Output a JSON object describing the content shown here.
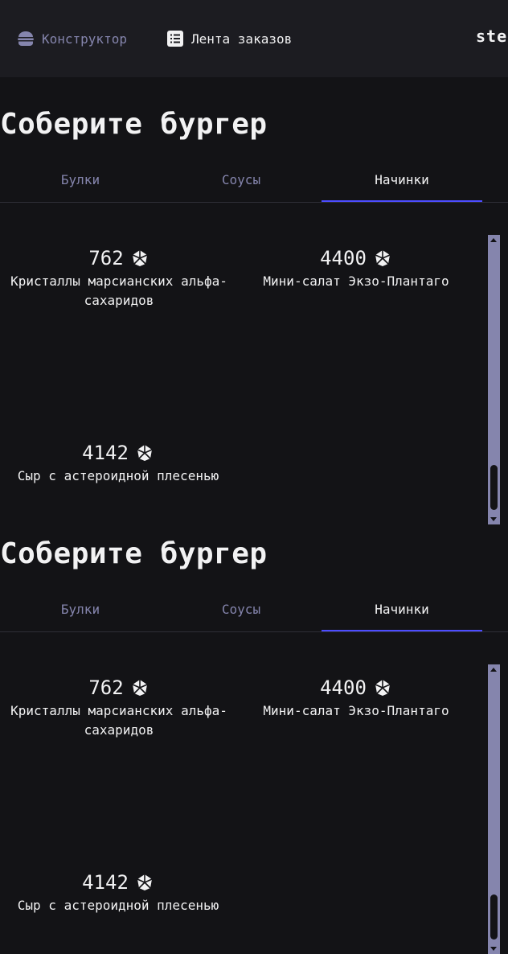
{
  "header": {
    "nav": {
      "constructor_label": "Конструктор",
      "feed_label": "Лента заказов"
    },
    "logo_text": "ste"
  },
  "sections": [
    {
      "title": "Соберите бургер",
      "tabs": [
        "Булки",
        "Соусы",
        "Начинки"
      ],
      "active_tab": "Начинки",
      "ingredients": [
        {
          "price": "762",
          "name": "Кристаллы марсианских альфа-сахаридов"
        },
        {
          "price": "4400",
          "name": "Мини-салат Экзо-Плантаго"
        },
        {
          "price": "4142",
          "name": "Сыр с астероидной плесенью"
        }
      ]
    },
    {
      "title": "Соберите бургер",
      "tabs": [
        "Булки",
        "Соусы",
        "Начинки"
      ],
      "active_tab": "Начинки",
      "ingredients": [
        {
          "price": "762",
          "name": "Кристаллы марсианских альфа-сахаридов"
        },
        {
          "price": "4400",
          "name": "Мини-салат Экзо-Плантаго"
        },
        {
          "price": "4142",
          "name": "Сыр с астероидной плесенью"
        }
      ]
    }
  ],
  "colors": {
    "background": "#131316",
    "header_background": "#1c1c21",
    "accent": "#4c4cff",
    "inactive": "#8585ad",
    "text": "#f2f2f3"
  },
  "icons": [
    "burger-icon",
    "list-icon",
    "currency-icon"
  ]
}
